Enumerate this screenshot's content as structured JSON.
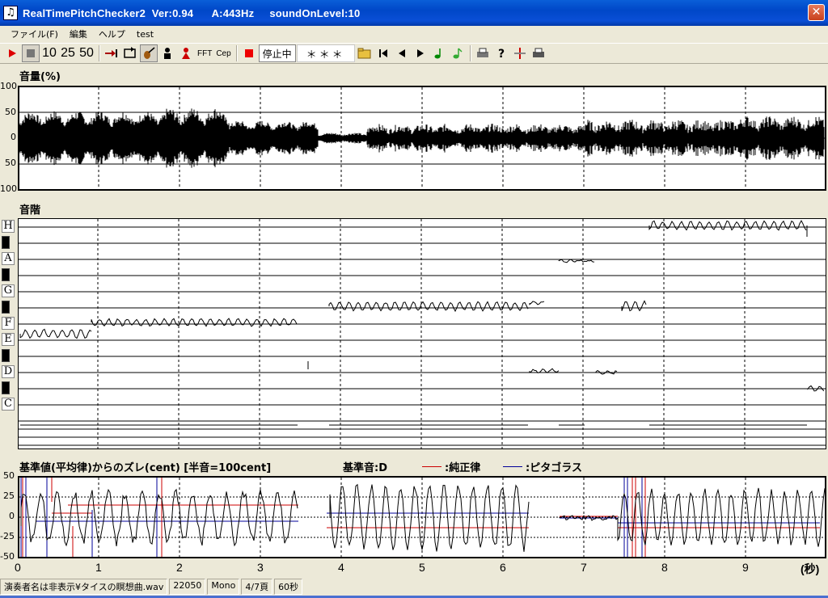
{
  "window": {
    "title": "RealTimePitchChecker2  Ver:0.94      A:443Hz     soundOnLevel:10",
    "close_glyph": "✕"
  },
  "menu": [
    "ファイル(F)",
    "編集",
    "ヘルプ",
    "test"
  ],
  "toolbar": {
    "presets": [
      "10",
      "25",
      "50"
    ],
    "fft_label": "FFT",
    "cep_label": "Cep",
    "status_text": "停止中",
    "indicator_text": "＊＊＊"
  },
  "volume_panel": {
    "title": "音量(%)",
    "y_labels": [
      "100",
      "50",
      "0",
      "50",
      "100"
    ]
  },
  "scale_panel": {
    "title": "音階",
    "notes": [
      "H",
      "A",
      "G",
      "F",
      "E",
      "D",
      "C"
    ]
  },
  "deviation_panel": {
    "title": "基準値(平均律)からのズレ(cent) [半音=100cent]",
    "base_note": "基準音:D",
    "legend": [
      {
        "label": ":純正律",
        "color": "#cc0000"
      },
      {
        "label": ":ピタゴラス",
        "color": "#000099"
      }
    ],
    "y_labels": [
      "50",
      "25",
      "0",
      "-25",
      "-50"
    ]
  },
  "x_axis": {
    "labels": [
      "0",
      "1",
      "2",
      "3",
      "4",
      "5",
      "6",
      "7",
      "8",
      "9"
    ],
    "unit": "(秒)"
  },
  "statusbar": [
    "演奏者名は非表示¥タイスの瞑想曲.wav",
    "22050",
    "Mono",
    "4/7頁",
    "60秒"
  ]
}
